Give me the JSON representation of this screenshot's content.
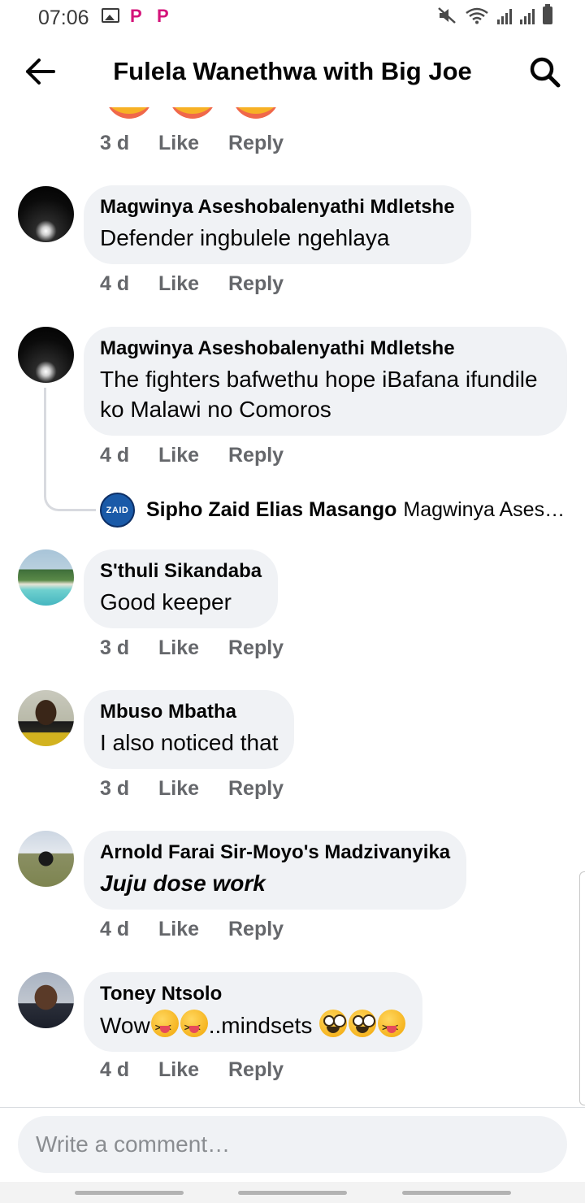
{
  "status_bar": {
    "time": "07:06",
    "left_icons": [
      "gallery-icon",
      "p-app-icon",
      "p-app-icon"
    ],
    "right_icons": [
      "mute-icon",
      "wifi-icon",
      "signal-icon",
      "signal-icon",
      "battery-icon"
    ]
  },
  "header": {
    "title": "Fulela Wanethwa with Big Joe",
    "back_icon": "arrow-left-icon",
    "search_icon": "search-icon"
  },
  "top_actions": {
    "time": "3 d",
    "like": "Like",
    "reply": "Reply"
  },
  "comments": [
    {
      "name": "Magwinya Aseshobalenyathi Mdletshe",
      "text": "Defender ingbulele ngehlaya",
      "time": "4 d",
      "like": "Like",
      "reply": "Reply"
    },
    {
      "name": "Magwinya Aseshobalenyathi Mdletshe",
      "text": "The fighters bafwethu hope iBafana ifundile ko Malawi no Comoros",
      "time": "4 d",
      "like": "Like",
      "reply": "Reply",
      "reply_preview": {
        "avatar_text": "ZAID",
        "name": "Sipho Zaid Elias Masango",
        "text": "Magwinya Aseshobalenyathi Mdletshe"
      }
    },
    {
      "name": "S'thuli Sikandaba",
      "text": "Good keeper",
      "time": "3 d",
      "like": "Like",
      "reply": "Reply"
    },
    {
      "name": "Mbuso Mbatha",
      "text": "I also noticed that",
      "time": "3 d",
      "like": "Like",
      "reply": "Reply"
    },
    {
      "name": "Arnold Farai Sir-Moyo's Madzivanyika",
      "text": "Juju dose work",
      "time": "4 d",
      "like": "Like",
      "reply": "Reply"
    },
    {
      "name": "Toney Ntsolo",
      "text_start": "Wow",
      "text_middle": "..mindsets",
      "emoji": [
        "squinting-tongue-emoji",
        "zany-face-emoji"
      ],
      "time": "4 d",
      "like": "Like",
      "reply": "Reply"
    }
  ],
  "composer": {
    "placeholder": "Write a comment…"
  },
  "colors": {
    "bubble_bg": "#f0f2f5",
    "meta_text": "#65676b",
    "primary_text": "#050505",
    "brand_p": "#d4147a"
  }
}
